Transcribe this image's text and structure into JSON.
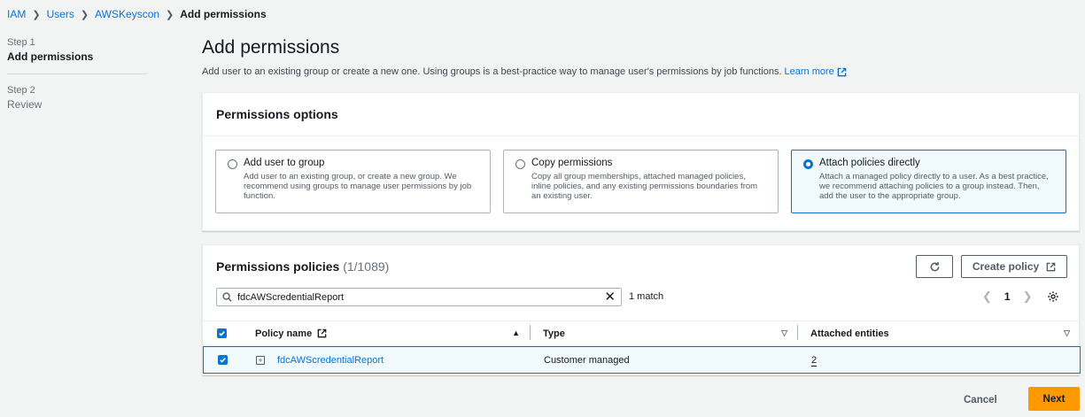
{
  "breadcrumb": {
    "items": [
      "IAM",
      "Users",
      "AWSKeyscon"
    ],
    "current": "Add permissions"
  },
  "steps": [
    {
      "num": "Step 1",
      "label": "Add permissions"
    },
    {
      "num": "Step 2",
      "label": "Review"
    }
  ],
  "header": {
    "title": "Add permissions",
    "description": "Add user to an existing group or create a new one. Using groups is a best-practice way to manage user's permissions by job functions.",
    "learn_more": "Learn more"
  },
  "permissions_options": {
    "title": "Permissions options",
    "options": [
      {
        "title": "Add user to group",
        "description": "Add user to an existing group, or create a new group. We recommend using groups to manage user permissions by job function.",
        "selected": false
      },
      {
        "title": "Copy permissions",
        "description": "Copy all group memberships, attached managed policies, inline policies, and any existing permissions boundaries from an existing user.",
        "selected": false
      },
      {
        "title": "Attach policies directly",
        "description": "Attach a managed policy directly to a user. As a best practice, we recommend attaching policies to a group instead. Then, add the user to the appropriate group.",
        "selected": true
      }
    ]
  },
  "policies": {
    "title": "Permissions policies",
    "count": "(1/1089)",
    "create_label": "Create policy",
    "search_value": "fdcAWScredentialReport",
    "match_text": "1 match",
    "page": "1",
    "columns": {
      "name": "Policy name",
      "type": "Type",
      "entities": "Attached entities"
    },
    "rows": [
      {
        "name": "fdcAWScredentialReport",
        "type": "Customer managed",
        "entities": "2",
        "checked": true
      }
    ]
  },
  "footer": {
    "cancel": "Cancel",
    "next": "Next"
  },
  "colors": {
    "link": "#0972d3",
    "primary_button": "#ff9900",
    "selected_bg": "#f1faff"
  }
}
